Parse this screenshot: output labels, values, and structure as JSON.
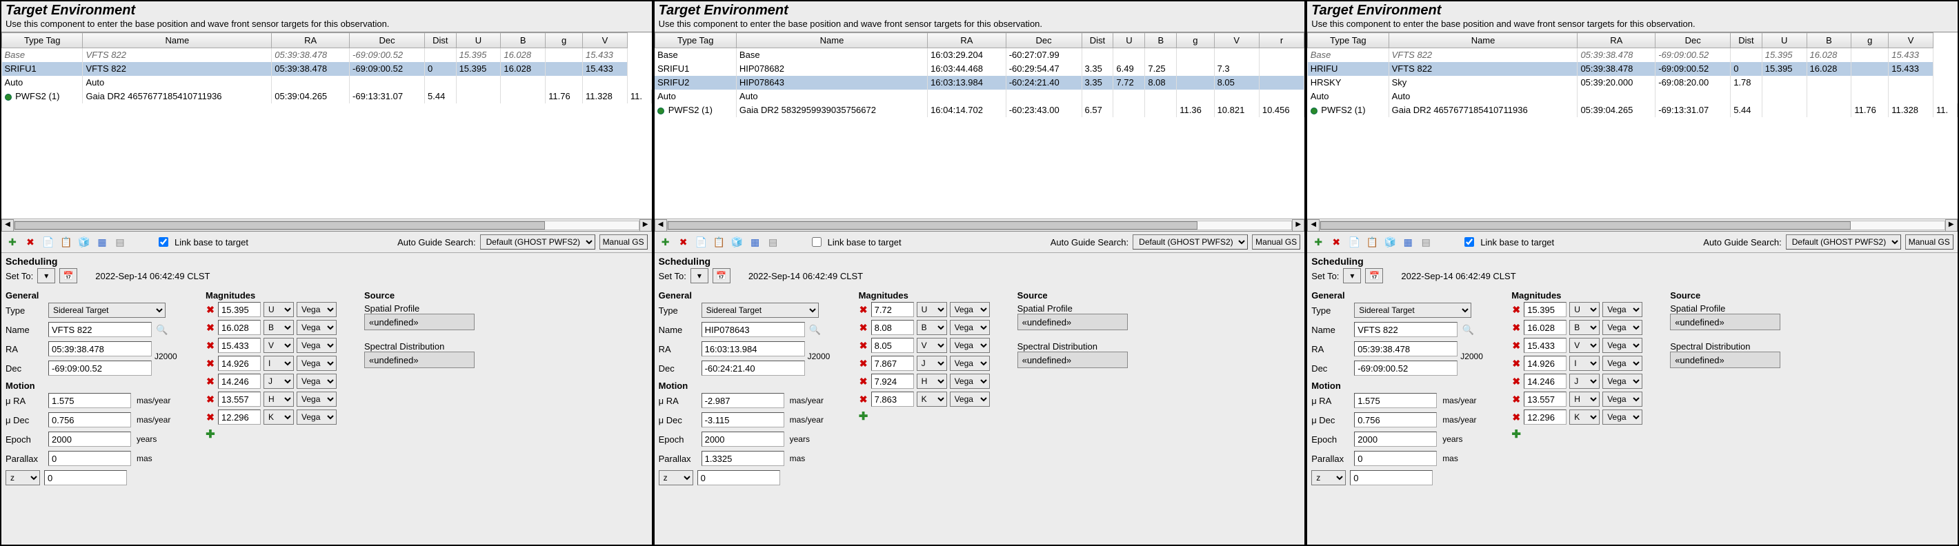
{
  "panels": [
    {
      "title": "Target Environment",
      "subtitle": "Use this component to enter the base position and wave front sensor targets for this observation.",
      "columns": [
        "Type Tag",
        "Name",
        "RA",
        "Dec",
        "Dist",
        "U",
        "B",
        "g",
        "V"
      ],
      "rows": [
        {
          "cls": "italic",
          "cells": [
            "Base",
            "VFTS 822",
            "05:39:38.478",
            "-69:09:00.52",
            "",
            "15.395",
            "16.028",
            "",
            "15.433"
          ]
        },
        {
          "cls": "sel",
          "cells": [
            "SRIFU1",
            "VFTS 822",
            "05:39:38.478",
            "-69:09:00.52",
            "0",
            "15.395",
            "16.028",
            "",
            "15.433"
          ]
        },
        {
          "cls": "normal",
          "cells": [
            "Auto",
            "Auto",
            "",
            "",
            "",
            "",
            "",
            "",
            ""
          ]
        },
        {
          "cls": "normal",
          "cells": [
            "● PWFS2 (1)",
            "Gaia DR2 4657677185410711936",
            "05:39:04.265",
            "-69:13:31.07",
            "5.44",
            "",
            "",
            "11.76",
            "11.328",
            "11."
          ]
        }
      ],
      "link_checked": true,
      "auto_guide_label": "Auto Guide Search:",
      "auto_guide_value": "Default (GHOST PWFS2)",
      "manual_gs": "Manual GS",
      "link_label": "Link base to target",
      "sched_title": "Scheduling",
      "set_to": "Set To:",
      "sched_time": "2022-Sep-14 06:42:49 CLST",
      "general_title": "General",
      "type_label": "Type",
      "type_value": "Sidereal Target",
      "name_label": "Name",
      "name_value": "VFTS 822",
      "ra_label": "RA",
      "ra_value": "05:39:38.478",
      "dec_label": "Dec",
      "dec_value": "-69:09:00.52",
      "epoch_sys": "J2000",
      "motion_title": "Motion",
      "mu_ra_label": "μ RA",
      "mu_ra_value": "1.575",
      "mu_ra_unit": "mas/year",
      "mu_dec_label": "μ Dec",
      "mu_dec_value": "0.756",
      "mu_dec_unit": "mas/year",
      "epoch_label": "Epoch",
      "epoch_value": "2000",
      "epoch_unit": "years",
      "plx_label": "Parallax",
      "plx_value": "0",
      "plx_unit": "mas",
      "z_label": "z",
      "z_value": "0",
      "mag_title": "Magnitudes",
      "mags": [
        {
          "v": "15.395",
          "b": "U",
          "s": "Vega"
        },
        {
          "v": "16.028",
          "b": "B",
          "s": "Vega"
        },
        {
          "v": "15.433",
          "b": "V",
          "s": "Vega"
        },
        {
          "v": "14.926",
          "b": "I",
          "s": "Vega"
        },
        {
          "v": "14.246",
          "b": "J",
          "s": "Vega"
        },
        {
          "v": "13.557",
          "b": "H",
          "s": "Vega"
        },
        {
          "v": "12.296",
          "b": "K",
          "s": "Vega"
        }
      ],
      "src_title": "Source",
      "sp_label": "Spatial Profile",
      "sp_value": "«undefined»",
      "sd_label": "Spectral Distribution",
      "sd_value": "«undefined»"
    },
    {
      "title": "Target Environment",
      "subtitle": "Use this component to enter the base position and wave front sensor targets for this observation.",
      "columns": [
        "Type Tag",
        "Name",
        "RA",
        "Dec",
        "Dist",
        "U",
        "B",
        "g",
        "V",
        "r"
      ],
      "rows": [
        {
          "cls": "normal",
          "cells": [
            "Base",
            "Base",
            "16:03:29.204",
            "-60:27:07.99",
            "",
            "",
            "",
            "",
            "",
            ""
          ]
        },
        {
          "cls": "normal",
          "cells": [
            "SRIFU1",
            "HIP078682",
            "16:03:44.468",
            "-60:29:54.47",
            "3.35",
            "6.49",
            "7.25",
            "",
            "7.3",
            ""
          ]
        },
        {
          "cls": "sel",
          "cells": [
            "SRIFU2",
            "HIP078643",
            "16:03:13.984",
            "-60:24:21.40",
            "3.35",
            "7.72",
            "8.08",
            "",
            "8.05",
            ""
          ]
        },
        {
          "cls": "normal",
          "cells": [
            "Auto",
            "Auto",
            "",
            "",
            "",
            "",
            "",
            "",
            "",
            ""
          ]
        },
        {
          "cls": "normal",
          "cells": [
            "● PWFS2 (1)",
            "Gaia DR2 5832959939035756672",
            "16:04:14.702",
            "-60:23:43.00",
            "6.57",
            "",
            "",
            "11.36",
            "10.821",
            "10.456"
          ]
        }
      ],
      "link_checked": false,
      "auto_guide_label": "Auto Guide Search:",
      "auto_guide_value": "Default (GHOST PWFS2)",
      "manual_gs": "Manual GS",
      "link_label": "Link base to target",
      "sched_title": "Scheduling",
      "set_to": "Set To:",
      "sched_time": "2022-Sep-14 06:42:49 CLST",
      "general_title": "General",
      "type_label": "Type",
      "type_value": "Sidereal Target",
      "name_label": "Name",
      "name_value": "HIP078643",
      "ra_label": "RA",
      "ra_value": "16:03:13.984",
      "dec_label": "Dec",
      "dec_value": "-60:24:21.40",
      "epoch_sys": "J2000",
      "motion_title": "Motion",
      "mu_ra_label": "μ RA",
      "mu_ra_value": "-2.987",
      "mu_ra_unit": "mas/year",
      "mu_dec_label": "μ Dec",
      "mu_dec_value": "-3.115",
      "mu_dec_unit": "mas/year",
      "epoch_label": "Epoch",
      "epoch_value": "2000",
      "epoch_unit": "years",
      "plx_label": "Parallax",
      "plx_value": "1.3325",
      "plx_unit": "mas",
      "z_label": "z",
      "z_value": "0",
      "mag_title": "Magnitudes",
      "mags": [
        {
          "v": "7.72",
          "b": "U",
          "s": "Vega"
        },
        {
          "v": "8.08",
          "b": "B",
          "s": "Vega"
        },
        {
          "v": "8.05",
          "b": "V",
          "s": "Vega"
        },
        {
          "v": "7.867",
          "b": "J",
          "s": "Vega"
        },
        {
          "v": "7.924",
          "b": "H",
          "s": "Vega"
        },
        {
          "v": "7.863",
          "b": "K",
          "s": "Vega"
        }
      ],
      "src_title": "Source",
      "sp_label": "Spatial Profile",
      "sp_value": "«undefined»",
      "sd_label": "Spectral Distribution",
      "sd_value": "«undefined»"
    },
    {
      "title": "Target Environment",
      "subtitle": "Use this component to enter the base position and wave front sensor targets for this observation.",
      "columns": [
        "Type Tag",
        "Name",
        "RA",
        "Dec",
        "Dist",
        "U",
        "B",
        "g",
        "V"
      ],
      "rows": [
        {
          "cls": "italic",
          "cells": [
            "Base",
            "VFTS 822",
            "05:39:38.478",
            "-69:09:00.52",
            "",
            "15.395",
            "16.028",
            "",
            "15.433"
          ]
        },
        {
          "cls": "sel",
          "cells": [
            "HRIFU",
            "VFTS 822",
            "05:39:38.478",
            "-69:09:00.52",
            "0",
            "15.395",
            "16.028",
            "",
            "15.433"
          ]
        },
        {
          "cls": "normal",
          "cells": [
            "HRSKY",
            "Sky",
            "05:39:20.000",
            "-69:08:20.00",
            "1.78",
            "",
            "",
            "",
            ""
          ]
        },
        {
          "cls": "normal",
          "cells": [
            "Auto",
            "Auto",
            "",
            "",
            "",
            "",
            "",
            "",
            ""
          ]
        },
        {
          "cls": "normal",
          "cells": [
            "● PWFS2 (1)",
            "Gaia DR2 4657677185410711936",
            "05:39:04.265",
            "-69:13:31.07",
            "5.44",
            "",
            "",
            "11.76",
            "11.328",
            "11."
          ]
        }
      ],
      "link_checked": true,
      "auto_guide_label": "Auto Guide Search:",
      "auto_guide_value": "Default (GHOST PWFS2)",
      "manual_gs": "Manual GS",
      "link_label": "Link base to target",
      "sched_title": "Scheduling",
      "set_to": "Set To:",
      "sched_time": "2022-Sep-14 06:42:49 CLST",
      "general_title": "General",
      "type_label": "Type",
      "type_value": "Sidereal Target",
      "name_label": "Name",
      "name_value": "VFTS 822",
      "ra_label": "RA",
      "ra_value": "05:39:38.478",
      "dec_label": "Dec",
      "dec_value": "-69:09:00.52",
      "epoch_sys": "J2000",
      "motion_title": "Motion",
      "mu_ra_label": "μ RA",
      "mu_ra_value": "1.575",
      "mu_ra_unit": "mas/year",
      "mu_dec_label": "μ Dec",
      "mu_dec_value": "0.756",
      "mu_dec_unit": "mas/year",
      "epoch_label": "Epoch",
      "epoch_value": "2000",
      "epoch_unit": "years",
      "plx_label": "Parallax",
      "plx_value": "0",
      "plx_unit": "mas",
      "z_label": "z",
      "z_value": "0",
      "mag_title": "Magnitudes",
      "mags": [
        {
          "v": "15.395",
          "b": "U",
          "s": "Vega"
        },
        {
          "v": "16.028",
          "b": "B",
          "s": "Vega"
        },
        {
          "v": "15.433",
          "b": "V",
          "s": "Vega"
        },
        {
          "v": "14.926",
          "b": "I",
          "s": "Vega"
        },
        {
          "v": "14.246",
          "b": "J",
          "s": "Vega"
        },
        {
          "v": "13.557",
          "b": "H",
          "s": "Vega"
        },
        {
          "v": "12.296",
          "b": "K",
          "s": "Vega"
        }
      ],
      "src_title": "Source",
      "sp_label": "Spatial Profile",
      "sp_value": "«undefined»",
      "sd_label": "Spectral Distribution",
      "sd_value": "«undefined»"
    }
  ]
}
